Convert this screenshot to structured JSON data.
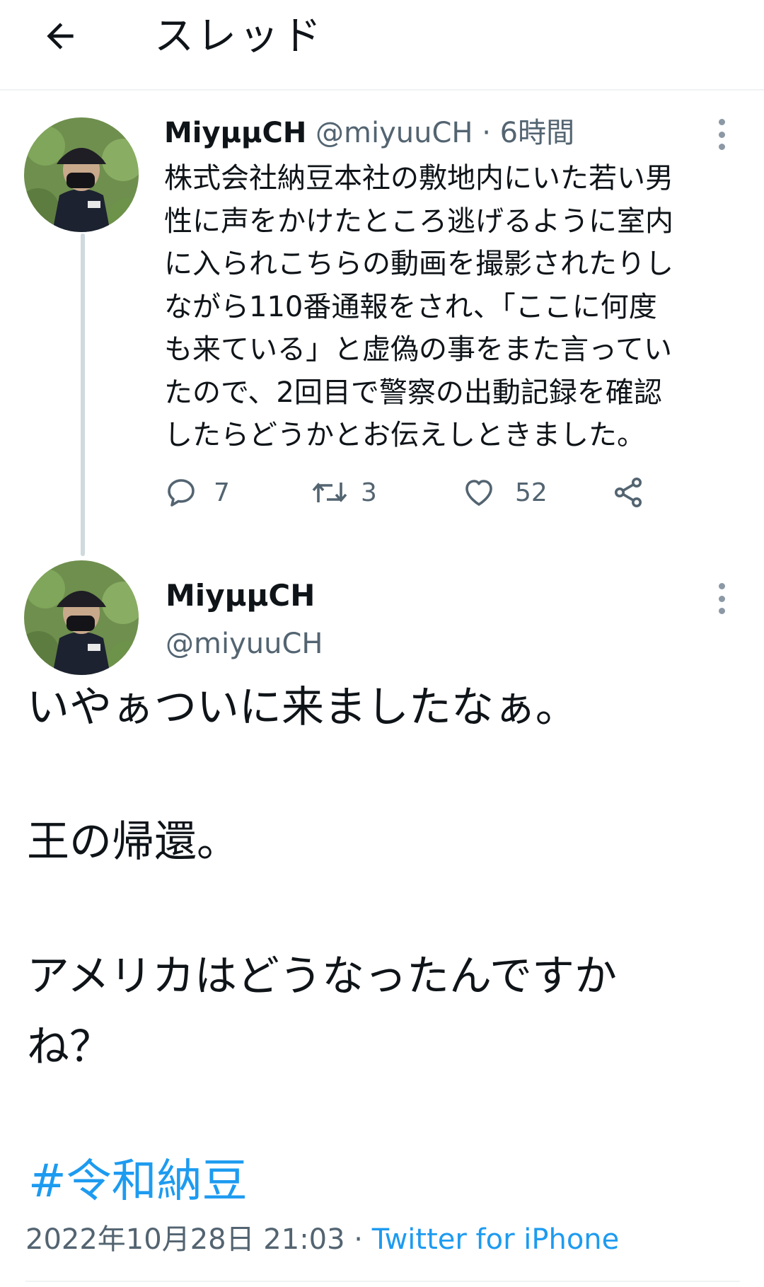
{
  "header": {
    "title": "スレッド"
  },
  "tweet1": {
    "display_name": "MiyμμCH",
    "handle": "@miyuuCH",
    "separator": " · ",
    "time": "6時間",
    "text_lines": [
      "株式会社納豆本社の敷地内にいた若い男",
      "性に声をかけたところ逃げるように室内",
      "に入られこちらの動画を撮影されたりし",
      "ながら110番通報をされ、「ここに何度",
      "も来ている」と虚偽の事をまた言ってい",
      "たので、2回目で警察の出動記録を確認",
      "したらどうかとお伝えしときました。"
    ],
    "reply_count": "7",
    "retweet_count": "3",
    "like_count": "52"
  },
  "tweet2": {
    "display_name": "MiyμμCH",
    "handle": "@miyuuCH",
    "paragraph1": "いやぁついに来ましたなぁ。",
    "paragraph2": "王の帰還。",
    "paragraph3_line1": "アメリカはどうなったんですか",
    "paragraph3_line2": "ね？",
    "hashtag": "#令和納豆",
    "timestamp": "2022年10月28日 21:03",
    "separator": " · ",
    "source": "Twitter for iPhone"
  },
  "icons": {
    "back": "arrow-left-icon",
    "more": "more-vertical-icon",
    "reply": "reply-icon",
    "retweet": "retweet-icon",
    "like": "heart-icon",
    "share": "share-icon"
  },
  "colors": {
    "link": "#1d9bf0",
    "secondary_text": "#536471",
    "divider": "#eff3f4"
  }
}
